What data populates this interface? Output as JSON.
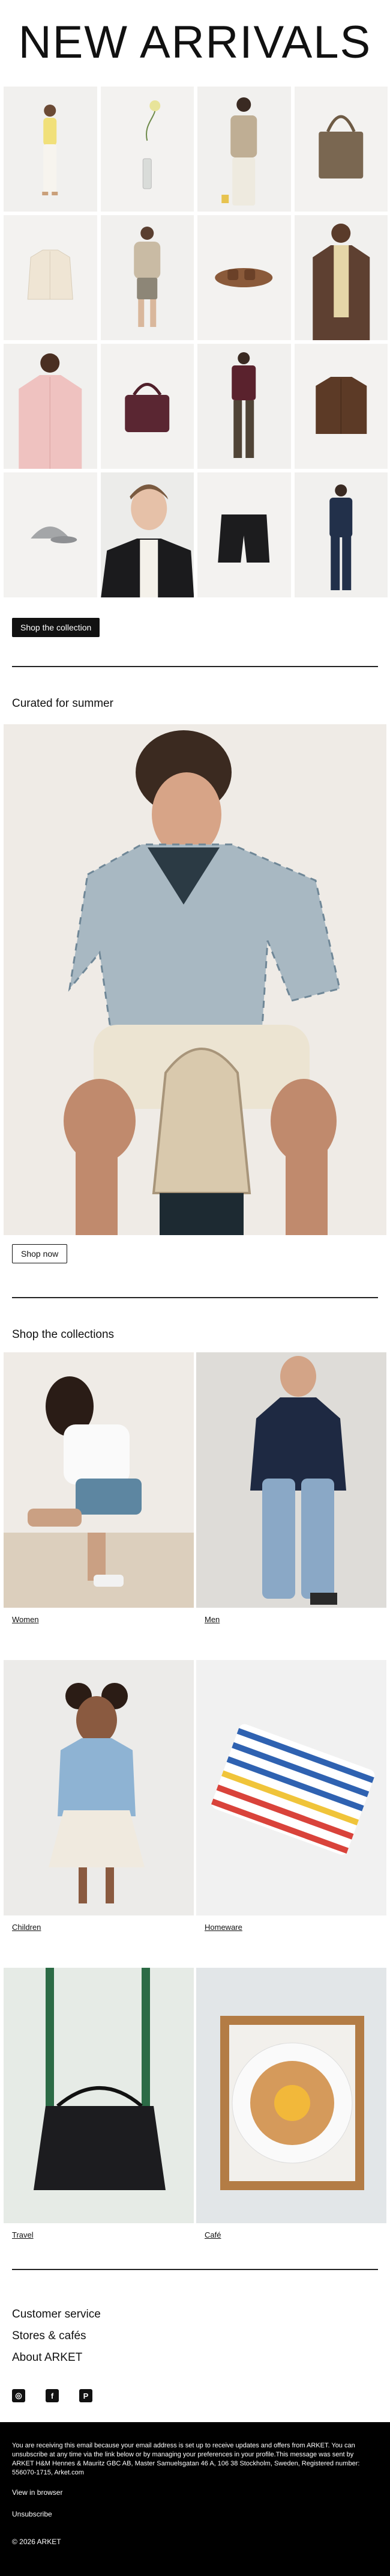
{
  "header": {
    "title": "NEW ARRIVALS"
  },
  "new_arrivals": {
    "items": [
      {
        "icon": "model-yellow-top-icon"
      },
      {
        "icon": "flower-vase-icon"
      },
      {
        "icon": "model-beige-tee-icon"
      },
      {
        "icon": "tote-bag-icon"
      },
      {
        "icon": "cream-shirt-icon"
      },
      {
        "icon": "model-sweater-icon"
      },
      {
        "icon": "sandal-icon"
      },
      {
        "icon": "model-brown-jacket-icon"
      },
      {
        "icon": "model-pink-shirt-icon"
      },
      {
        "icon": "burgundy-bag-icon"
      },
      {
        "icon": "model-burgundy-shirt-icon"
      },
      {
        "icon": "brown-overshirt-icon"
      },
      {
        "icon": "grey-cap-icon"
      },
      {
        "icon": "model-portrait-icon"
      },
      {
        "icon": "black-shorts-icon"
      },
      {
        "icon": "model-navy-suit-icon"
      }
    ],
    "cta": "Shop the collection"
  },
  "curated": {
    "title": "Curated for summer",
    "cta": "Shop now"
  },
  "collections": {
    "title": "Shop the collections",
    "items": [
      {
        "label": "Women"
      },
      {
        "label": "Men"
      },
      {
        "label": "Children"
      },
      {
        "label": "Homeware"
      },
      {
        "label": "Travel"
      },
      {
        "label": "Café"
      }
    ]
  },
  "footer": {
    "customer_service": "Customer service",
    "stores": "Stores & cafés",
    "about": "About ARKET",
    "social": [
      {
        "name": "instagram-icon",
        "glyph": "◎"
      },
      {
        "name": "facebook-icon",
        "glyph": "f"
      },
      {
        "name": "pinterest-icon",
        "glyph": "P"
      }
    ],
    "legal": "You are receiving this email because your email address is set up to receive updates and offers from ARKET. You can unsubscribe at any time via the link below or by managing your preferences in your profile.This message was sent by ARKET H&M Hennes & Mauritz GBC AB, Master Samuelsgatan 46 A, 106 38 Stockholm, Sweden, Registered number: 556070-1715, Arket.com",
    "view_browser": "View in browser",
    "unsubscribe": "Unsubscribe",
    "copyright": "© 2026 ARKET"
  },
  "colors": {
    "black": "#000000",
    "background": "#ffffff",
    "tile": "#f1f0ee"
  }
}
